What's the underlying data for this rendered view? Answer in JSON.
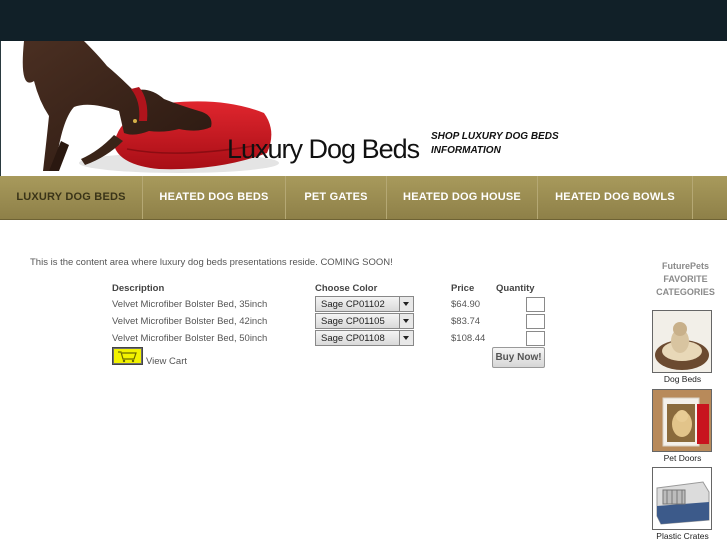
{
  "header": {
    "logo": "Luxury Dog Beds",
    "links": [
      "SHOP LUXURY DOG BEDS",
      "INFORMATION"
    ]
  },
  "nav": {
    "items": [
      "LUXURY DOG BEDS",
      "HEATED DOG BEDS",
      "PET GATES",
      "HEATED DOG HOUSE",
      "HEATED DOG BOWLS"
    ],
    "active": "LUXURY DOG BEDS"
  },
  "content": {
    "intro": "This is the content area where luxury dog beds presentations reside. COMING SOON!",
    "columns": {
      "description": "Description",
      "color": "Choose Color",
      "price": "Price",
      "quantity": "Quantity"
    },
    "products": [
      {
        "description": "Velvet Microfiber Bolster Bed, 35inch",
        "color": "Sage CP01102",
        "price": "$64.90",
        "quantity": ""
      },
      {
        "description": "Velvet Microfiber Bolster Bed, 42inch",
        "color": "Sage CP01105",
        "price": "$83.74",
        "quantity": ""
      },
      {
        "description": "Velvet Microfiber Bolster Bed, 50inch",
        "color": "Sage CP01108",
        "price": "$108.44",
        "quantity": ""
      }
    ],
    "buy_label": "Buy Now!",
    "view_cart": "View Cart"
  },
  "sidebar": {
    "heading": [
      "FuturePets",
      "FAVORITE",
      "CATEGORIES"
    ],
    "categories": [
      "Dog Beds",
      "Pet Doors",
      "Plastic Crates"
    ]
  },
  "colors": {
    "topbar": "#112028",
    "nav": "#9a8c52",
    "accent_pillow": "#c8141e"
  },
  "icons": [
    "shopping-cart-icon",
    "dropdown-arrow-icon"
  ]
}
